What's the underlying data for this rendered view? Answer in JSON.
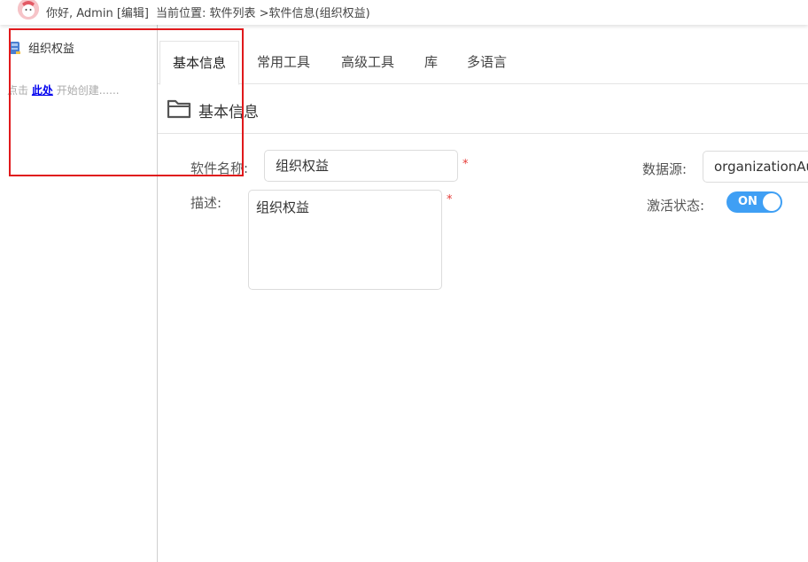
{
  "header": {
    "greeting": "你好, Admin [编辑]",
    "breadcrumb": "当前位置: 软件列表 >软件信息(组织权益)"
  },
  "sidebar": {
    "tree_node_label": "组织权益",
    "hint_prefix": "点击",
    "hint_link": "此处",
    "hint_suffix": "开始创建......"
  },
  "tabs": [
    {
      "label": "基本信息",
      "active": true
    },
    {
      "label": "常用工具"
    },
    {
      "label": "高级工具"
    },
    {
      "label": "库"
    },
    {
      "label": "多语言"
    }
  ],
  "section": {
    "title": "基本信息"
  },
  "form": {
    "software_name_label": "软件名称:",
    "software_name_value": "组织权益",
    "required_mark": "*",
    "description_label": "描述:",
    "description_value": "组织权益",
    "datasource_label": "数据源:",
    "datasource_value": "organizationAu",
    "active_state_label": "激活状态:",
    "active_toggle_text": "ON"
  },
  "colors": {
    "accent": "#3f9ff4",
    "highlight_box": "#e0191c",
    "required": "#e53935"
  }
}
